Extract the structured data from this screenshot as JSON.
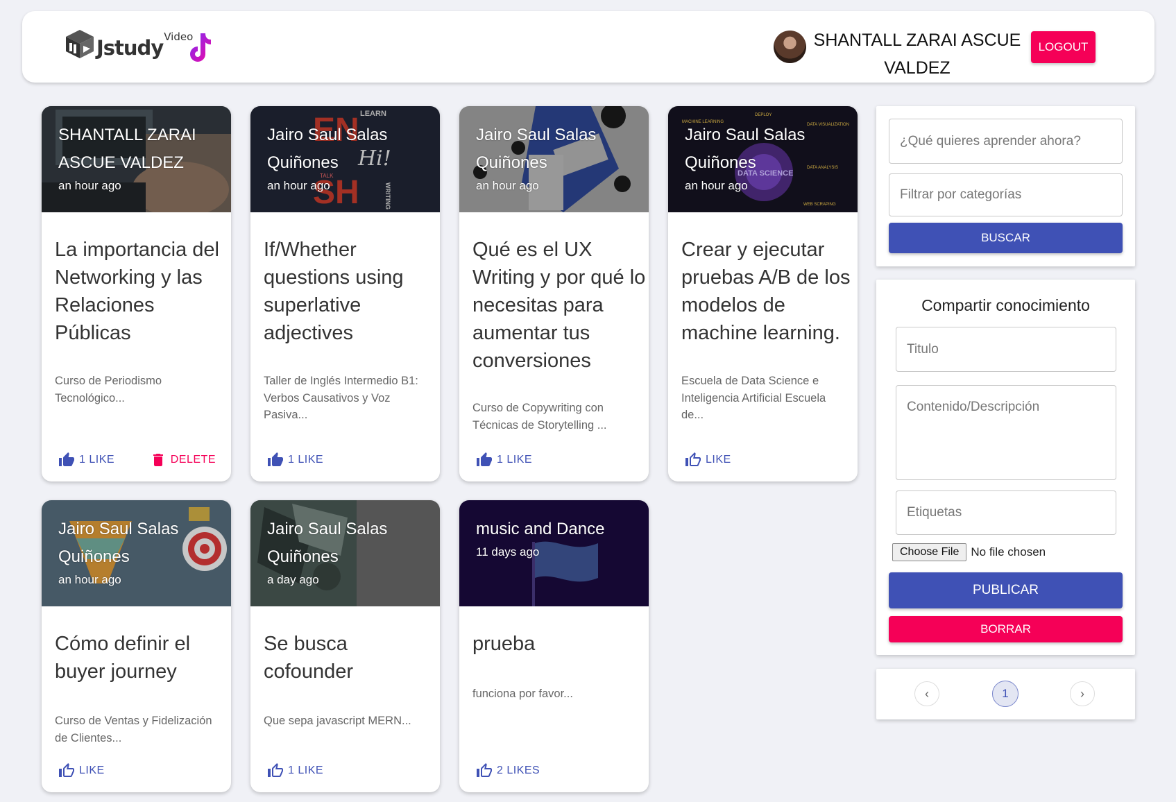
{
  "header": {
    "logo_text": "Jstudy",
    "logo_sup": "Video",
    "user_name": "SHANTALL ZARAI ASCUE VALDEZ",
    "logout_label": "LOGOUT"
  },
  "posts": [
    {
      "author": "SHANTALL ZARAI ASCUE VALDEZ",
      "time": "an hour ago",
      "title": "La importancia del Networking y las Relaciones Públicas",
      "desc": "Curso de Periodismo Tecnológico...",
      "like_label": "1 LIKE",
      "delete_label": "DELETE"
    },
    {
      "author": "Jairo Saul Salas Quiñones",
      "time": "an hour ago",
      "title": "If/Whether questions using superlative adjectives",
      "desc": "Taller de Inglés Intermedio B1: Verbos Causativos y Voz Pasiva...",
      "like_label": "1 LIKE"
    },
    {
      "author": "Jairo Saul Salas Quiñones",
      "time": "an hour ago",
      "title": "Qué es el UX Writing y por qué lo necesitas para aumentar tus conversiones",
      "desc": "Curso de Copywriting con Técnicas de Storytelling ...",
      "like_label": "1 LIKE"
    },
    {
      "author": "Jairo Saul Salas Quiñones",
      "time": "an hour ago",
      "title": "Crear y ejecutar pruebas A/B de los modelos de machine learning.",
      "desc": "Escuela de Data Science e Inteligencia Artificial Escuela de...",
      "like_label": "LIKE"
    },
    {
      "author": "Jairo Saul Salas Quiñones",
      "time": "an hour ago",
      "title": "Cómo definir el buyer journey",
      "desc": "Curso de Ventas y Fidelización de Clientes...",
      "like_label": "LIKE"
    },
    {
      "author": "Jairo Saul Salas Quiñones",
      "time": "a day ago",
      "title": "Se busca cofounder",
      "desc": "Que sepa javascript MERN...",
      "like_label": "1 LIKE"
    },
    {
      "author": "music and Dance",
      "time": "11 days ago",
      "title": "prueba",
      "desc": "funciona por favor...",
      "like_label": "2 LIKES"
    }
  ],
  "media_text": {
    "p2_a": "LEARN",
    "p2_b": "EN",
    "p2_c": "Hi!",
    "p2_d": "SH",
    "p2_e": "WRITING",
    "p2_f": "TALK",
    "p4_a": "MACHINE LEARNING",
    "p4_b": "DATA SCIENCE",
    "p4_c": "DATA VISUALIZATION",
    "p4_d": "DATA ANALYSIS",
    "p4_e": "WEB SCRAPING",
    "p4_f": "DEPLOY"
  },
  "search": {
    "query_placeholder": "¿Qué quieres aprender ahora?",
    "category_placeholder": "Filtrar por categorías",
    "button_label": "BUSCAR"
  },
  "share": {
    "title": "Compartir conocimiento",
    "title_placeholder": "Titulo",
    "content_placeholder": "Contenido/Descripción",
    "tags_placeholder": "Etiquetas",
    "file_button": "Choose File",
    "file_status": "No file chosen",
    "publish_label": "PUBLICAR",
    "clear_label": "BORRAR"
  },
  "pagination": {
    "prev_icon": "‹",
    "page": "1",
    "next_icon": "›"
  },
  "colors": {
    "primary": "#3f51b5",
    "secondary": "#f50057",
    "background": "#f0f1f6"
  }
}
